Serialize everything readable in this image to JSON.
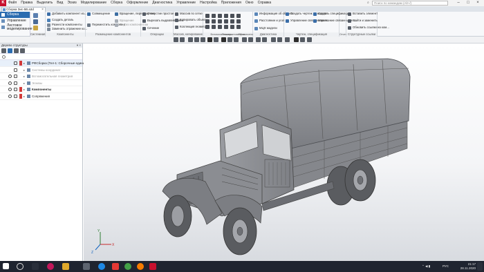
{
  "menu": {
    "items": [
      "Файл",
      "Правка",
      "Выделить",
      "Вид",
      "Эскиз",
      "Моделирование",
      "Сборка",
      "Оформление",
      "Диагностика",
      "Управление",
      "Настройка",
      "Приложения",
      "Окно",
      "Справка"
    ],
    "search_placeholder": "Поиск по командам (Alt+/)"
  },
  "tab": {
    "title": "Сборка Зис-5В.a3d"
  },
  "ribbon": {
    "nav": [
      "Сборка",
      "Управление",
      "Листовое моделирование"
    ],
    "groups": [
      {
        "label": "Системная",
        "buttons": [
          "Создать",
          "Сохранить",
          "Открыть"
        ]
      },
      {
        "label": "Компоненты",
        "buttons": [
          "Добавить компонент из...",
          "Создать деталь",
          "Разнести компоненты",
          "Заменить отражение ко..."
        ]
      },
      {
        "label": "Размещение компонентов",
        "buttons": [
          "Совмещение",
          "Переместить компонент",
          "Вращение, перемещение",
          "Вращение",
          "Вид из компонентом"
        ]
      },
      {
        "label": "Операции",
        "buttons": [
          "Отверстие простое",
          "Вырезать выдавливанием",
          "Сечение"
        ]
      },
      {
        "label": "Массив, копирование",
        "buttons": [
          "Массив по сетке",
          "Копировать объекты",
          "Коллекция геометрии"
        ]
      },
      {
        "label": "Вспомогательная геометрия",
        "buttons": []
      },
      {
        "label": "Размеры",
        "buttons": []
      },
      {
        "label": "Обозначения",
        "buttons": []
      },
      {
        "label": "Диагностика",
        "buttons": [
          "Информация об объекте",
          "Расстояние и угол",
          "МЦХ модели"
        ]
      },
      {
        "label": "Чертеж, спецификация",
        "buttons": [
          "Создать чертеж по модели",
          "Управление связанными ч...",
          "Создать спецификацию",
          "Управление связанными с..."
        ]
      },
      {
        "label": "Отчеты",
        "buttons": []
      },
      {
        "label": "Структурные ссылки",
        "buttons": [
          "Вставить элемент",
          "Найти и заменить",
          "Обновить ссылки на ком..."
        ]
      }
    ]
  },
  "tree": {
    "title": "Дерево структуры",
    "rows": [
      {
        "label": "РФСборка (Тел-1: Сборочные единиц...",
        "eye": false,
        "mark": true,
        "style": "first"
      },
      {
        "label": "Системы координат",
        "eye": false,
        "mark": false,
        "style": "dim"
      },
      {
        "label": "Вспомогательная геометрия",
        "eye": true,
        "mark": false,
        "style": "dim"
      },
      {
        "label": "Эскизы",
        "eye": true,
        "mark": false,
        "style": "dim"
      },
      {
        "label": "Компоненты",
        "eye": true,
        "mark": true,
        "style": "bold"
      },
      {
        "label": "Сопряжения",
        "eye": true,
        "mark": true,
        "style": "normal"
      }
    ]
  },
  "axes": {
    "x": "X",
    "y": "Y",
    "z": "Z"
  },
  "tray": {
    "lang": "РУС",
    "time": "21:17",
    "date": "28.11.2020"
  },
  "colors": {
    "accent": "#2b6cb0",
    "brand": "#c8102e",
    "model": "#8d8f93"
  }
}
